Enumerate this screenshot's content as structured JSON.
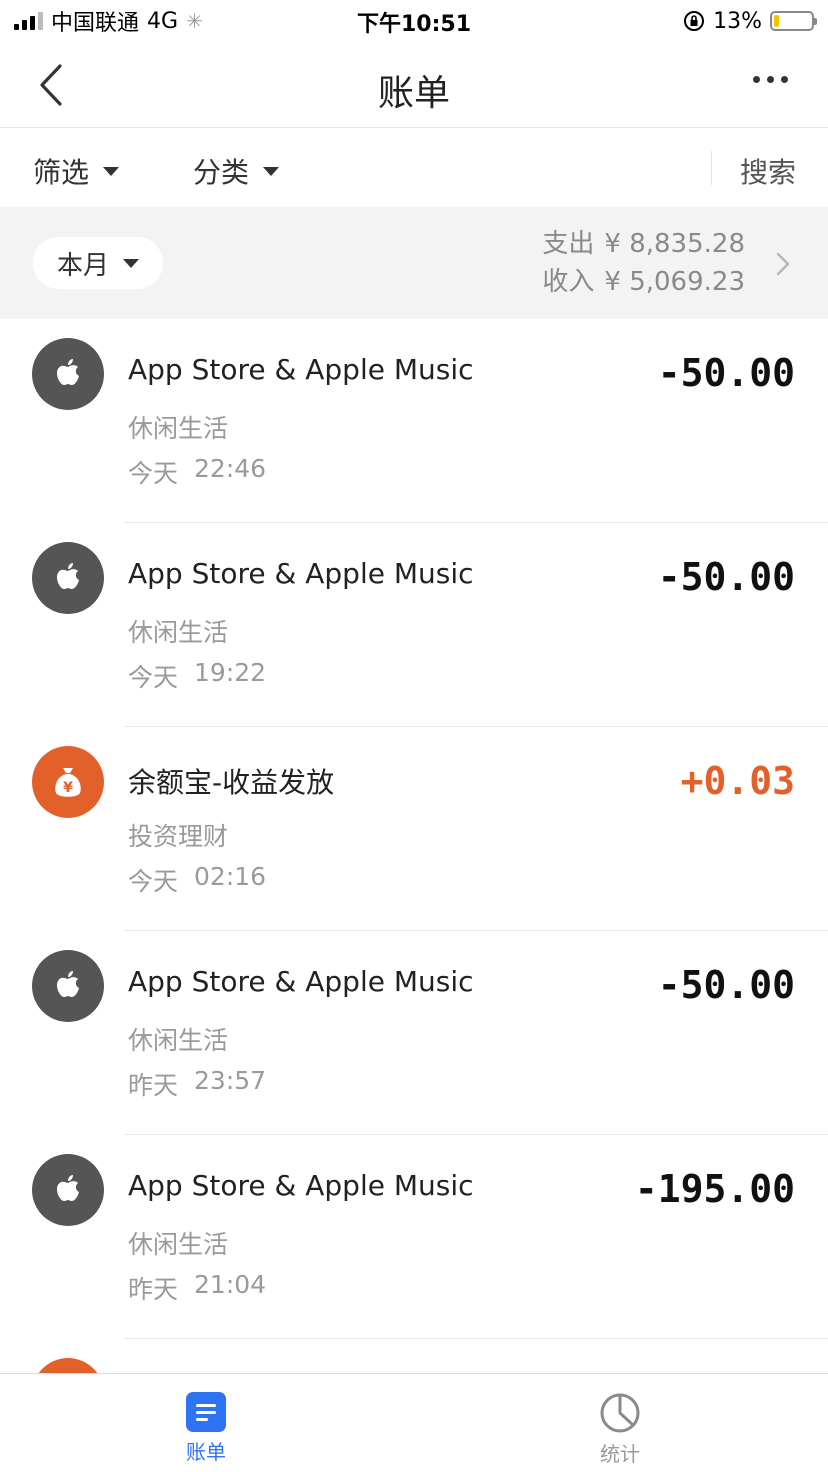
{
  "status_bar": {
    "carrier": "中国联通",
    "network": "4G",
    "time": "下午10:51",
    "battery": "13%",
    "battery_level": 0.13
  },
  "nav": {
    "title": "账单",
    "back_icon": "chevron-left-icon",
    "more_icon": "more-dots-icon"
  },
  "filters": {
    "filter_label": "筛选",
    "category_label": "分类",
    "search_label": "搜索"
  },
  "summary": {
    "period": "本月",
    "expense_label": "支出",
    "expense_amount": "¥ 8,835.28",
    "income_label": "收入",
    "income_amount": "¥ 5,069.23"
  },
  "transactions": [
    {
      "name": "App Store & Apple Music",
      "category": "休闲生活",
      "day": "今天",
      "time": "22:46",
      "amount": "-50.00",
      "icon": "apple-icon",
      "type": "expense"
    },
    {
      "name": "App Store & Apple Music",
      "category": "休闲生活",
      "day": "今天",
      "time": "19:22",
      "amount": "-50.00",
      "icon": "apple-icon",
      "type": "expense"
    },
    {
      "name": "余额宝-收益发放",
      "category": "投资理财",
      "day": "今天",
      "time": "02:16",
      "amount": "+0.03",
      "icon": "money-bag-icon",
      "type": "income"
    },
    {
      "name": "App Store & Apple Music",
      "category": "休闲生活",
      "day": "昨天",
      "time": "23:57",
      "amount": "-50.00",
      "icon": "apple-icon",
      "type": "expense"
    },
    {
      "name": "App Store & Apple Music",
      "category": "休闲生活",
      "day": "昨天",
      "time": "21:04",
      "amount": "-195.00",
      "icon": "apple-icon",
      "type": "expense"
    }
  ],
  "tab_bar": {
    "bills_label": "账单",
    "stats_label": "统计"
  },
  "colors": {
    "accent_blue": "#2f73f5",
    "income_orange": "#e2612b",
    "apple_icon_bg": "#555555"
  }
}
